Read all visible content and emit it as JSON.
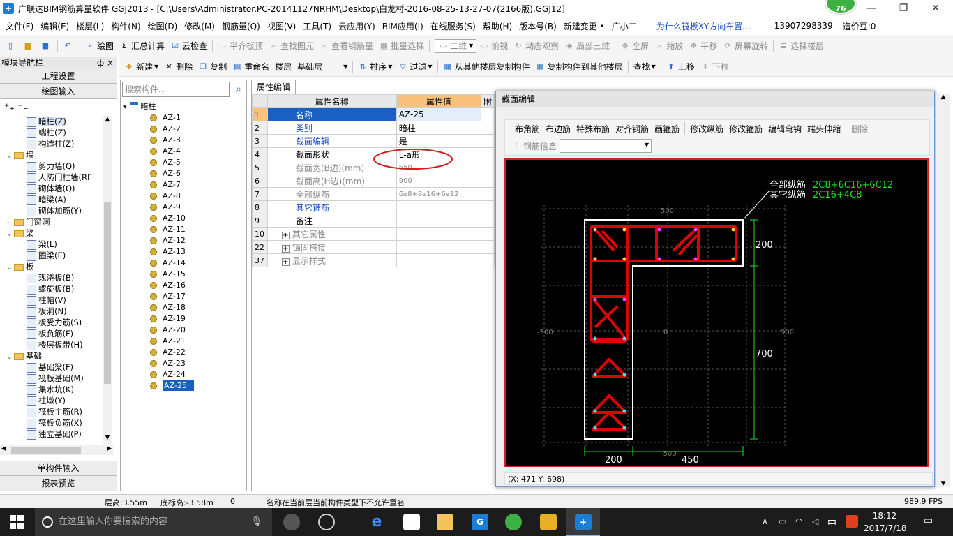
{
  "window": {
    "title": "广联达BIM钢筋算量软件 GGJ2013 - [C:\\Users\\Administrator.PC-20141127NRHM\\Desktop\\白龙村-2016-08-25-13-27-07(2166版).GGJ12]",
    "badge": "76"
  },
  "menu": [
    "文件(F)",
    "编辑(E)",
    "楼层(L)",
    "构件(N)",
    "绘图(D)",
    "修改(M)",
    "钢筋量(Q)",
    "视图(V)",
    "工具(T)",
    "云应用(Y)",
    "BIM应用(I)",
    "在线服务(S)",
    "帮助(H)",
    "版本号(B)",
    "新建变更 •",
    "广小二"
  ],
  "menu_right": {
    "question": "为什么筏板XY方向布置...",
    "phone": "13907298339",
    "coins": "造价豆:0"
  },
  "toolbar1": {
    "draw": "绘图",
    "sum": "汇总计算",
    "cloud": "云检查",
    "flat": "平齐板顶",
    "find": "查找图元",
    "view_steel": "查看钢筋量",
    "batch": "批量选择",
    "view2d": "二维",
    "topview": "俯视",
    "dynamic": "动态观察",
    "local3d": "局部三维",
    "fullscreen": "全屏",
    "zoom": "缩放",
    "pan": "平移",
    "rotate": "屏幕旋转",
    "select_floor": "选择楼层"
  },
  "toolbar2": {
    "new": "新建",
    "delete": "删除",
    "copy": "复制",
    "rename": "重命名",
    "floor": "楼层",
    "base": "基础层",
    "sort": "排序",
    "filter": "过滤",
    "copy_from": "从其他楼层复制构件",
    "copy_to": "复制构件到其他楼层",
    "find": "查找",
    "up": "上移",
    "down": "下移"
  },
  "nav": {
    "header": "模块导航栏",
    "pin": "ф ×",
    "btn_project": "工程设置",
    "btn_draw": "绘图输入",
    "btn_single": "单构件输入",
    "btn_report": "报表预览"
  },
  "nav_tree": [
    {
      "label": "暗柱(Z)",
      "level": 2,
      "type": "item",
      "sel": true
    },
    {
      "label": "端柱(Z)",
      "level": 2,
      "type": "item"
    },
    {
      "label": "构造柱(Z)",
      "level": 2,
      "type": "item"
    },
    {
      "label": "墙",
      "level": 1,
      "type": "folder",
      "open": true
    },
    {
      "label": "剪力墙(Q)",
      "level": 2,
      "type": "item"
    },
    {
      "label": "人防门框墙(RF",
      "level": 2,
      "type": "item"
    },
    {
      "label": "砌体墙(Q)",
      "level": 2,
      "type": "item"
    },
    {
      "label": "暗梁(A)",
      "level": 2,
      "type": "item"
    },
    {
      "label": "砌体加筋(Y)",
      "level": 2,
      "type": "item"
    },
    {
      "label": "门窗洞",
      "level": 1,
      "type": "folder",
      "open": false
    },
    {
      "label": "梁",
      "level": 1,
      "type": "folder",
      "open": true
    },
    {
      "label": "梁(L)",
      "level": 2,
      "type": "item"
    },
    {
      "label": "圈梁(E)",
      "level": 2,
      "type": "item"
    },
    {
      "label": "板",
      "level": 1,
      "type": "folder",
      "open": true
    },
    {
      "label": "现浇板(B)",
      "level": 2,
      "type": "item"
    },
    {
      "label": "螺旋板(B)",
      "level": 2,
      "type": "item"
    },
    {
      "label": "柱帽(V)",
      "level": 2,
      "type": "item"
    },
    {
      "label": "板洞(N)",
      "level": 2,
      "type": "item"
    },
    {
      "label": "板受力筋(S)",
      "level": 2,
      "type": "item"
    },
    {
      "label": "板负筋(F)",
      "level": 2,
      "type": "item"
    },
    {
      "label": "楼层板带(H)",
      "level": 2,
      "type": "item"
    },
    {
      "label": "基础",
      "level": 1,
      "type": "folder",
      "open": true
    },
    {
      "label": "基础梁(F)",
      "level": 2,
      "type": "item"
    },
    {
      "label": "筏板基础(M)",
      "level": 2,
      "type": "item"
    },
    {
      "label": "集水坑(K)",
      "level": 2,
      "type": "item"
    },
    {
      "label": "柱墩(Y)",
      "level": 2,
      "type": "item"
    },
    {
      "label": "筏板主筋(R)",
      "level": 2,
      "type": "item"
    },
    {
      "label": "筏板负筋(X)",
      "level": 2,
      "type": "item"
    },
    {
      "label": "独立基础(P)",
      "level": 2,
      "type": "item"
    }
  ],
  "list": {
    "search_placeholder": "搜索构件...",
    "root": "暗柱",
    "items": [
      "AZ-1",
      "AZ-2",
      "AZ-3",
      "AZ-4",
      "AZ-5",
      "AZ-6",
      "AZ-7",
      "AZ-8",
      "AZ-9",
      "AZ-10",
      "AZ-11",
      "AZ-12",
      "AZ-13",
      "AZ-14",
      "AZ-15",
      "AZ-16",
      "AZ-17",
      "AZ-18",
      "AZ-19",
      "AZ-20",
      "AZ-21",
      "AZ-22",
      "AZ-23",
      "AZ-24",
      "AZ-25"
    ],
    "selected": "AZ-25"
  },
  "props": {
    "tab": "属性编辑",
    "col_name": "属性名称",
    "col_value": "属性值",
    "col_extra": "附",
    "rows": [
      {
        "n": "1",
        "name": "名称",
        "value": "AZ-25",
        "style": "blue"
      },
      {
        "n": "2",
        "name": "类别",
        "value": "暗柱",
        "style": "blue"
      },
      {
        "n": "3",
        "name": "截面编辑",
        "value": "是",
        "style": "blue"
      },
      {
        "n": "4",
        "name": "截面形状",
        "value": "L-a形",
        "style": "black"
      },
      {
        "n": "5",
        "name": "截面宽(B边)(mm)",
        "value": "650",
        "style": "grey"
      },
      {
        "n": "6",
        "name": "截面高(H边)(mm)",
        "value": "900",
        "style": "grey"
      },
      {
        "n": "7",
        "name": "全部纵筋",
        "value": "6⌀8+8⌀16+6⌀12",
        "style": "grey"
      },
      {
        "n": "8",
        "name": "其它箍筋",
        "value": "",
        "style": "blue"
      },
      {
        "n": "9",
        "name": "备注",
        "value": "",
        "style": "black"
      },
      {
        "n": "10",
        "name": "其它属性",
        "value": "",
        "style": "grey",
        "exp": true
      },
      {
        "n": "22",
        "name": "锚固搭接",
        "value": "",
        "style": "grey",
        "exp": true
      },
      {
        "n": "37",
        "name": "显示样式",
        "value": "",
        "style": "grey",
        "exp": true
      }
    ]
  },
  "section": {
    "title": "截面编辑",
    "tools": [
      "布角筋",
      "布边筋",
      "特殊布筋",
      "对齐钢筋",
      "画箍筋",
      "修改纵筋",
      "修改箍筋",
      "编辑弯钩",
      "端头伸缩",
      "删除"
    ],
    "steel_info": "钢筋信息",
    "label_all": "全部纵筋",
    "value_all": "2C8+6C16+6C12",
    "label_other": "其它纵筋",
    "value_other": "2C16+4C8",
    "dim_left": "200",
    "dim_right": "450",
    "dim_top": "200",
    "dim_mid": "700",
    "grid_labels": [
      "500",
      "-500",
      "0",
      "900",
      "-500"
    ],
    "coord": "(X: 471 Y: 698)"
  },
  "status": {
    "floor_h": "层高:3.55m",
    "base_h": "底标高:-3.58m",
    "zero": "0",
    "msg": "名称在当前层当前构件类型下不允许重名",
    "fps": "989.9 FPS"
  },
  "taskbar": {
    "search": "在这里输入你要搜索的内容",
    "time": "18:12",
    "date": "2017/7/18",
    "ime": "中"
  }
}
